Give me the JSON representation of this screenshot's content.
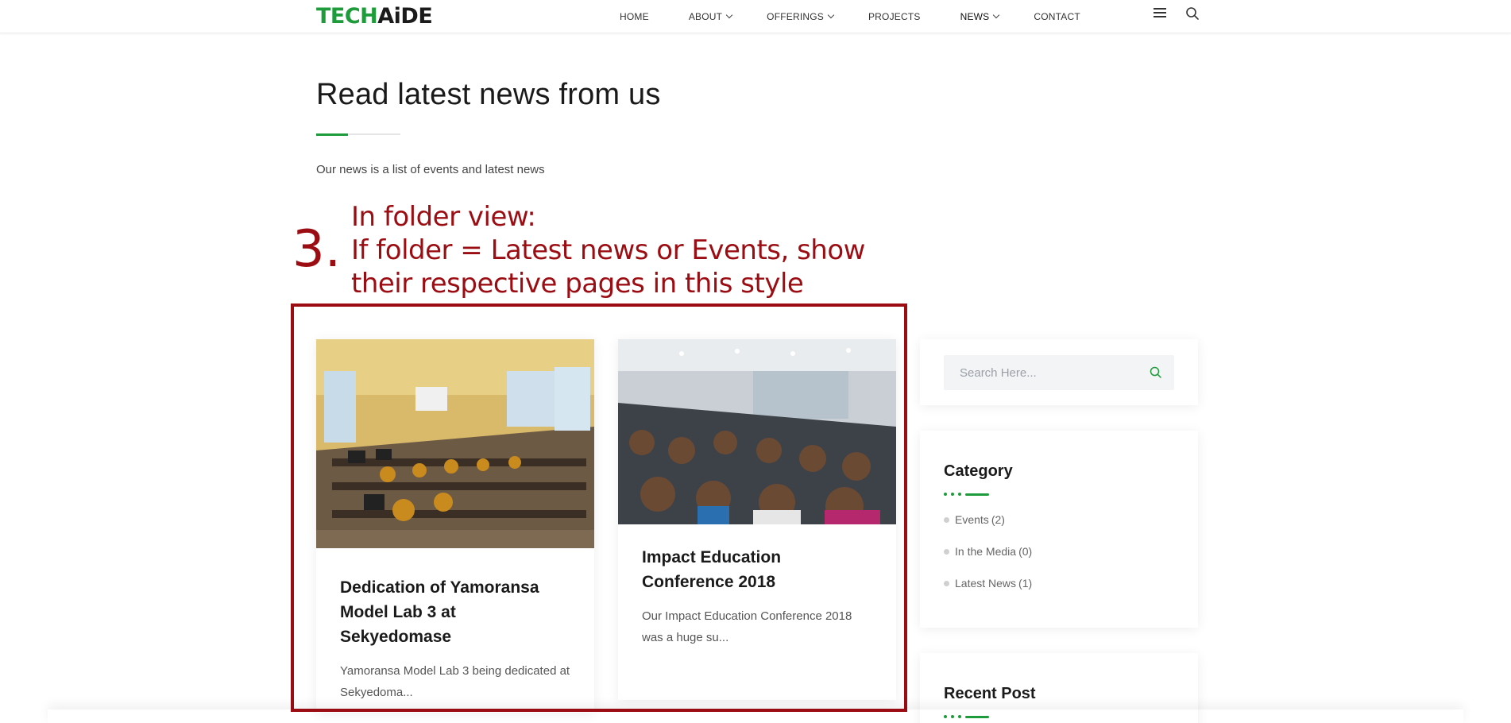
{
  "header": {
    "logo_tech": "TECH",
    "logo_aide": "AiDE",
    "nav": [
      {
        "label": "HOME"
      },
      {
        "label": "ABOUT"
      },
      {
        "label": "OFFERINGS"
      },
      {
        "label": "PROJECTS"
      },
      {
        "label": "NEWS"
      },
      {
        "label": "CONTACT"
      }
    ],
    "menu_icon": "hamburger-icon",
    "search_icon": "search-icon"
  },
  "hero": {
    "title": "Read latest news from us",
    "subtitle": "Our news is a list of events and latest news"
  },
  "annotation": {
    "number": "3.",
    "line1": "In folder view:",
    "line2": "If folder = Latest news or Events, show their respective pages in this style"
  },
  "posts": [
    {
      "title": "Dedication of Yamoransa Model Lab 3 at Sekyedomase",
      "excerpt": "Yamoransa Model Lab 3 being dedicated at Sekyedoma..."
    },
    {
      "title": "Impact Education Conference 2018",
      "excerpt": "Our Impact Education Conference 2018 was a huge su..."
    }
  ],
  "sidebar": {
    "search_placeholder": "Search Here...",
    "category_title": "Category",
    "categories": [
      {
        "name": "Events",
        "count": "(2)"
      },
      {
        "name": "In the Media",
        "count": "(0)"
      },
      {
        "name": "Latest News",
        "count": "(1)"
      }
    ],
    "recent_title": "Recent Post"
  },
  "colors": {
    "brand_green": "#1e9b3a",
    "annotation_red": "#9b0d12"
  }
}
